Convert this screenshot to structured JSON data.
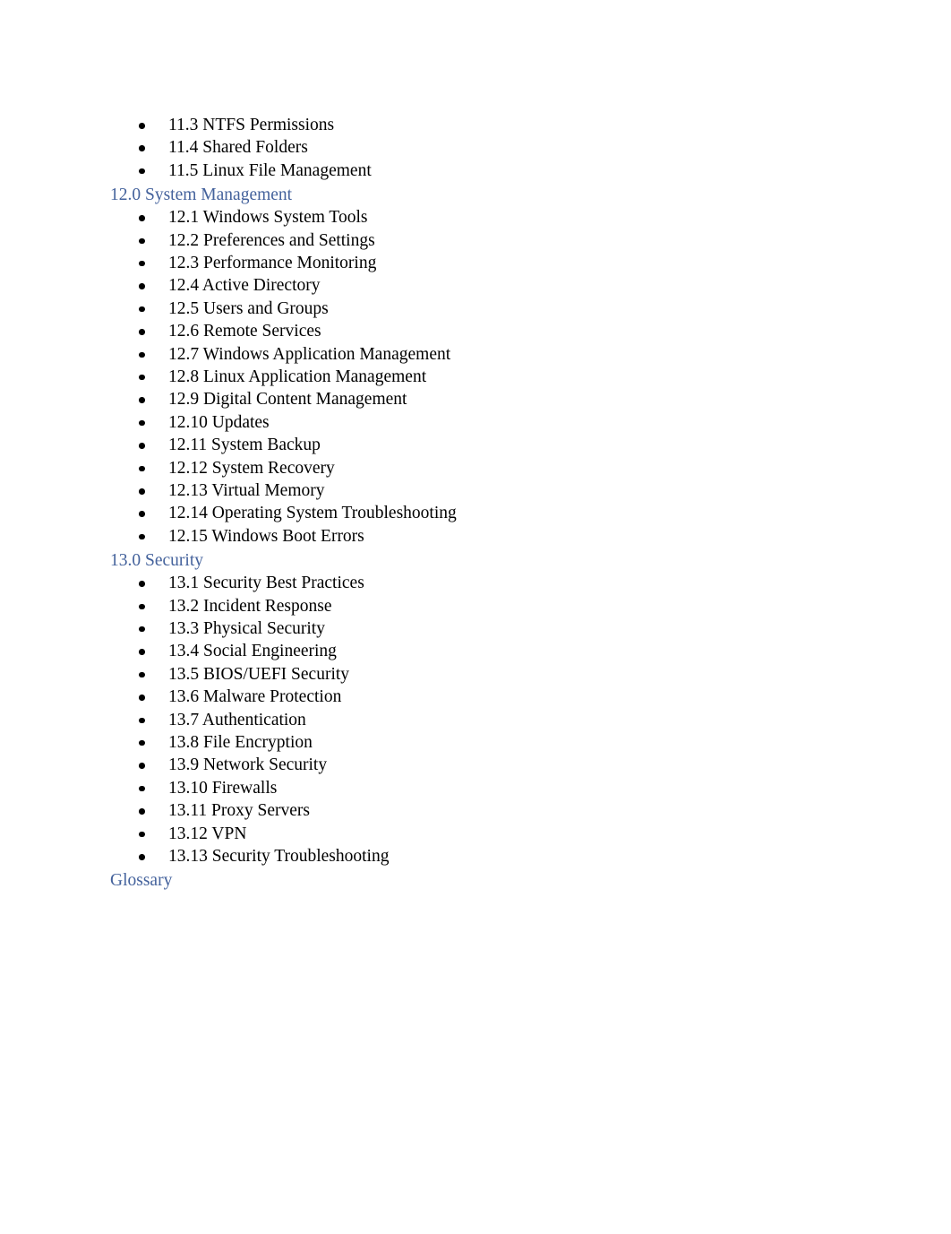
{
  "document": {
    "type": "table-of-contents",
    "page_background": "#ffffff",
    "body_text_color": "#000000",
    "heading_link_color": "#44629c"
  },
  "entries": [
    {
      "kind": "bullet",
      "label": "11.3 NTFS Permissions"
    },
    {
      "kind": "bullet",
      "label": "11.4 Shared Folders"
    },
    {
      "kind": "bullet",
      "label": "11.5 Linux File Management"
    },
    {
      "kind": "heading",
      "label": "12.0 System Management"
    },
    {
      "kind": "bullet",
      "label": "12.1 Windows System Tools"
    },
    {
      "kind": "bullet",
      "label": "12.2 Preferences and Settings"
    },
    {
      "kind": "bullet",
      "label": "12.3 Performance Monitoring"
    },
    {
      "kind": "bullet",
      "label": "12.4 Active Directory"
    },
    {
      "kind": "bullet",
      "label": "12.5 Users and Groups"
    },
    {
      "kind": "bullet",
      "label": "12.6 Remote Services"
    },
    {
      "kind": "bullet",
      "label": "12.7 Windows Application Management"
    },
    {
      "kind": "bullet",
      "label": "12.8 Linux Application Management"
    },
    {
      "kind": "bullet",
      "label": "12.9 Digital Content Management"
    },
    {
      "kind": "bullet",
      "label": "12.10 Updates"
    },
    {
      "kind": "bullet",
      "label": "12.11 System Backup"
    },
    {
      "kind": "bullet",
      "label": "12.12 System Recovery"
    },
    {
      "kind": "bullet",
      "label": "12.13 Virtual Memory"
    },
    {
      "kind": "bullet",
      "label": "12.14 Operating System Troubleshooting"
    },
    {
      "kind": "bullet",
      "label": "12.15 Windows Boot Errors"
    },
    {
      "kind": "heading",
      "label": "13.0 Security"
    },
    {
      "kind": "bullet",
      "label": "13.1 Security Best Practices"
    },
    {
      "kind": "bullet",
      "label": "13.2 Incident Response"
    },
    {
      "kind": "bullet",
      "label": "13.3 Physical Security"
    },
    {
      "kind": "bullet",
      "label": "13.4 Social Engineering"
    },
    {
      "kind": "bullet",
      "label": "13.5 BIOS/UEFI Security"
    },
    {
      "kind": "bullet",
      "label": "13.6 Malware Protection"
    },
    {
      "kind": "bullet",
      "label": "13.7 Authentication"
    },
    {
      "kind": "bullet",
      "label": "13.8 File Encryption"
    },
    {
      "kind": "bullet",
      "label": "13.9 Network Security"
    },
    {
      "kind": "bullet",
      "label": "13.10 Firewalls"
    },
    {
      "kind": "bullet",
      "label": "13.11 Proxy Servers"
    },
    {
      "kind": "bullet",
      "label": "13.12 VPN"
    },
    {
      "kind": "bullet",
      "label": "13.13 Security Troubleshooting"
    },
    {
      "kind": "heading",
      "label": "Glossary"
    }
  ]
}
